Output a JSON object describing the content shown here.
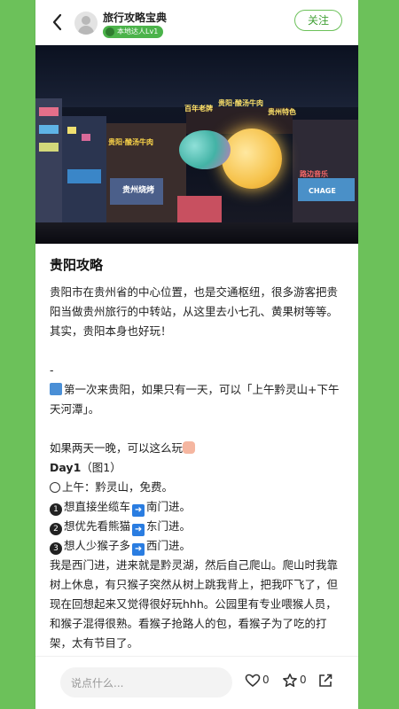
{
  "header": {
    "back_icon": "chevron-left-icon",
    "author": "旅行攻略宝典",
    "badge": "本地达人Lv1",
    "follow": "关注"
  },
  "hero": {
    "signs": [
      "百年老牌",
      "贵阳·酸汤牛肉",
      "贵州特色",
      "贵阳·酸汤牛肉",
      "贵州烧烤",
      "路边音乐",
      "CHAGE"
    ]
  },
  "post": {
    "title": "贵阳攻略",
    "intro": "贵阳市在贵州省的中心位置，也是交通枢纽，很多游客把贵阳当做贵州旅行的中转站，从这里去小七孔、黄果树等等。",
    "intro2": "其实，贵阳本身也好玩！",
    "dash": "-",
    "one_day": "第一次来贵阳，如果只有一天，可以「上午黔灵山+下午天河潭」。",
    "two_day": "如果两天一晚，可以这么玩",
    "day1_label": "Day1",
    "day1_note": "（图1）",
    "morning": "上午：黔灵山，免费。",
    "opt1": "想直接坐缆车",
    "opt1_dest": "南门进。",
    "opt2": "想优先看熊猫",
    "opt2_dest": "东门进。",
    "opt3": "想人少猴子多",
    "opt3_dest": "西门进。",
    "story": "我是西门进，进来就是黔灵湖，然后自己爬山。爬山时我靠树上休息，有只猴子突然从树上跳我背上，把我吓飞了，但现在回想起来又觉得很好玩hhh。公园里有专业喂猴人员，和猴子混得很熟。看猴子抢路人的包，看猴子为了吃的打架，太有节目了。"
  },
  "footer": {
    "comment_placeholder": "说点什么...",
    "likes": "0",
    "stars": "0"
  },
  "colors": {
    "background": "#6cc15a",
    "accent": "#3f9f33",
    "badge": "#4bb34a"
  }
}
